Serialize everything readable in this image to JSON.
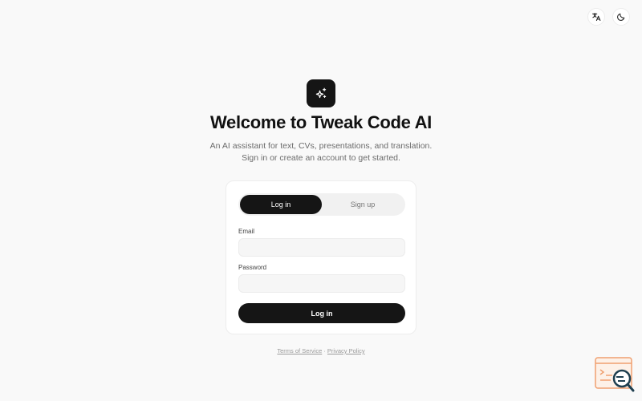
{
  "header": {
    "language_icon": "translate-icon",
    "theme_icon": "moon-icon"
  },
  "logo": {
    "icon": "sparkles-icon"
  },
  "hero": {
    "title": "Welcome to Tweak Code AI",
    "subtitle_line1": "An AI assistant for text, CVs, presentations, and translation.",
    "subtitle_line2": "Sign in or create an account to get started."
  },
  "auth": {
    "tabs": [
      {
        "label": "Log in",
        "active": true
      },
      {
        "label": "Sign up",
        "active": false
      }
    ],
    "email_label": "Email",
    "email_value": "",
    "password_label": "Password",
    "password_value": "",
    "submit_label": "Log in"
  },
  "footer": {
    "terms": "Terms of Service",
    "separator": " · ",
    "privacy": "Privacy Policy"
  },
  "widget": {
    "icon": "search-chat-icon"
  },
  "colors": {
    "background": "#f9f9f9",
    "primary": "#151515",
    "widget_accent": "#f0a070"
  }
}
